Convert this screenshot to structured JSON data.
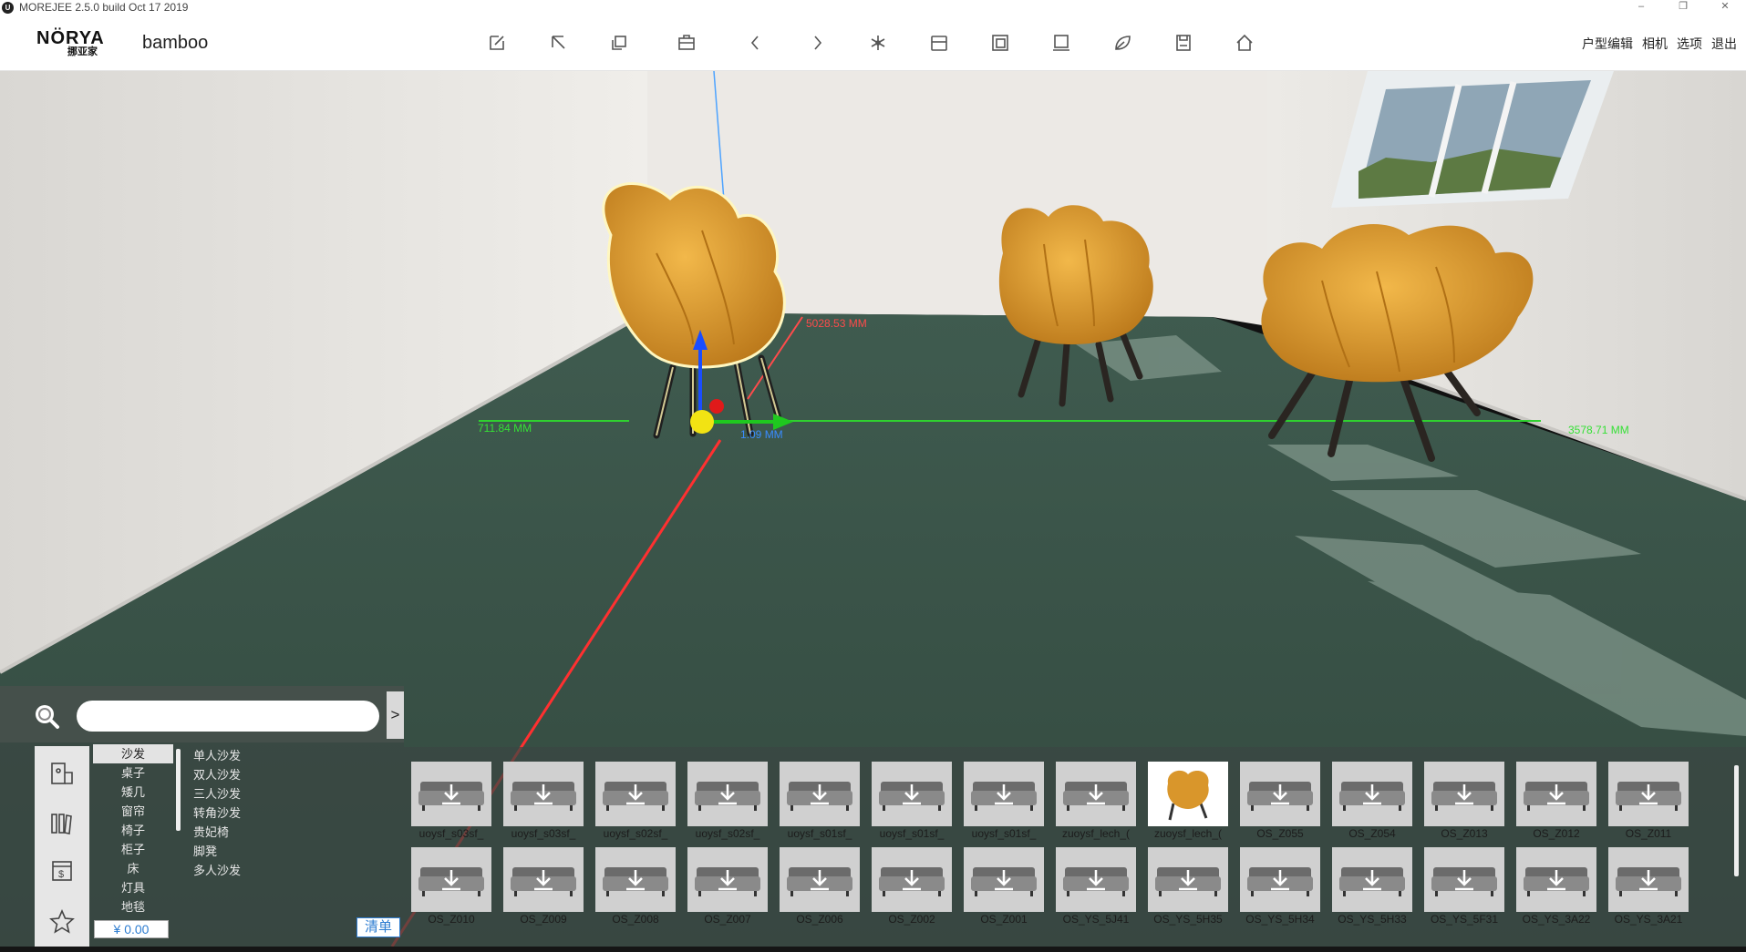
{
  "window": {
    "title": "MOREJEE 2.5.0 build Oct 17 2019",
    "icon_letter": "U"
  },
  "toolbar": {
    "logo_main": "NÖRYA",
    "logo_sub": "挪亚家",
    "project_name": "bamboo",
    "icons": [
      "edit-icon",
      "select-arrow-icon",
      "copy-icon",
      "briefcase-icon",
      "undo-icon",
      "redo-icon",
      "snowflake-icon",
      "cabinet-icon",
      "layers-icon",
      "panel-icon",
      "leaf-icon",
      "save-icon",
      "home-icon"
    ]
  },
  "menu": {
    "floorplan": "户型编辑",
    "camera": "相机",
    "options": "选项",
    "exit": "退出"
  },
  "viewport": {
    "measure_left": "711.84 MM",
    "measure_right": "3578.71 MM",
    "measure_back": "5028.53 MM",
    "measure_up": "1.09 MM",
    "colors": {
      "floor": "#3d5a4d",
      "wall": "#e8e6e2",
      "chair": "#d9962b"
    }
  },
  "search": {
    "placeholder": "",
    "value": "",
    "expand_label": ">"
  },
  "categories": {
    "items": [
      "沙发",
      "桌子",
      "矮几",
      "窗帘",
      "椅子",
      "柜子",
      "床",
      "灯具",
      "地毯"
    ],
    "active": "沙发",
    "sub_items": [
      "单人沙发",
      "双人沙发",
      "三人沙发",
      "转角沙发",
      "贵妃椅",
      "脚凳",
      "多人沙发"
    ],
    "price": "¥ 0.00",
    "list_label": "清单"
  },
  "products": {
    "row1": [
      "uoysf_s03sf_",
      "uoysf_s03sf_",
      "uoysf_s02sf_",
      "uoysf_s02sf_",
      "uoysf_s01sf_",
      "uoysf_s01sf_",
      "uoysf_s01sf_",
      "zuoysf_lech_(",
      "zuoysf_lech_(",
      "OS_Z055",
      "OS_Z054",
      "OS_Z013",
      "OS_Z012",
      "OS_Z011"
    ],
    "row2": [
      "OS_Z010",
      "OS_Z009",
      "OS_Z008",
      "OS_Z007",
      "OS_Z006",
      "OS_Z002",
      "OS_Z001",
      "OS_YS_5J41",
      "OS_YS_5H35",
      "OS_YS_5H34",
      "OS_YS_5H33",
      "OS_YS_5F31",
      "OS_YS_3A22",
      "OS_YS_3A21"
    ],
    "selected_index_row1": 8
  }
}
